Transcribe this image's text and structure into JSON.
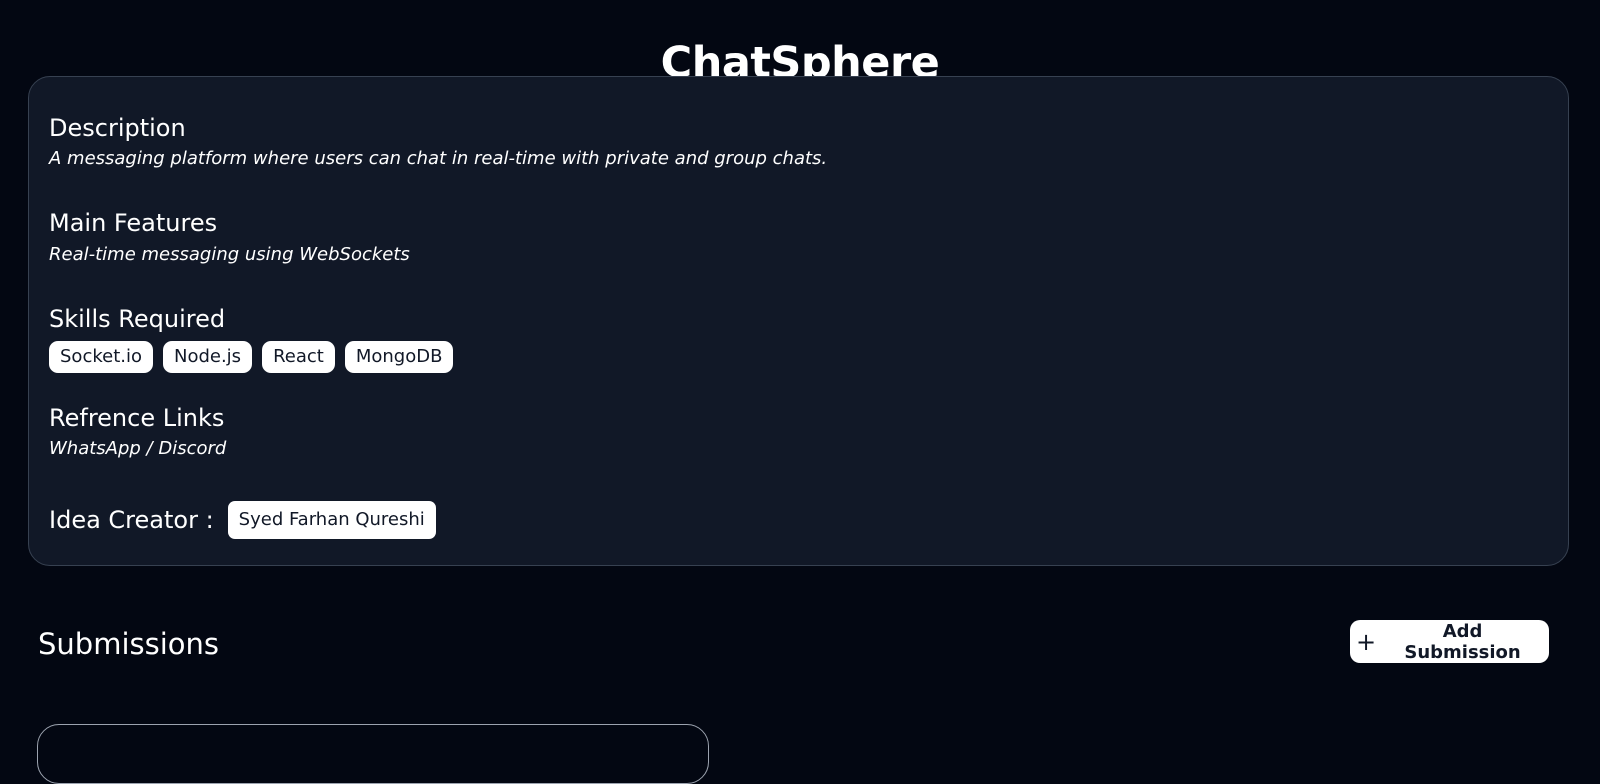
{
  "page": {
    "title": "ChatSphere"
  },
  "project": {
    "description_heading": "Description",
    "description_text": "A messaging platform where users can chat in real-time with private and group chats.",
    "features_heading": "Main Features",
    "features_text": "Real-time messaging using WebSockets",
    "skills_heading": "Skills Required",
    "skills": [
      "Socket.io",
      "Node.js",
      "React",
      "MongoDB"
    ],
    "links_heading": "Refrence Links",
    "links_text": "WhatsApp / Discord",
    "creator_label": "Idea Creator :",
    "creator_name": "Syed Farhan Qureshi"
  },
  "submissions": {
    "title": "Submissions",
    "add_button_label": "Add Submission",
    "add_button_icon": "plus-icon"
  },
  "colors": {
    "background": "#030712",
    "card": "#111827",
    "chip": "#ffffff"
  }
}
